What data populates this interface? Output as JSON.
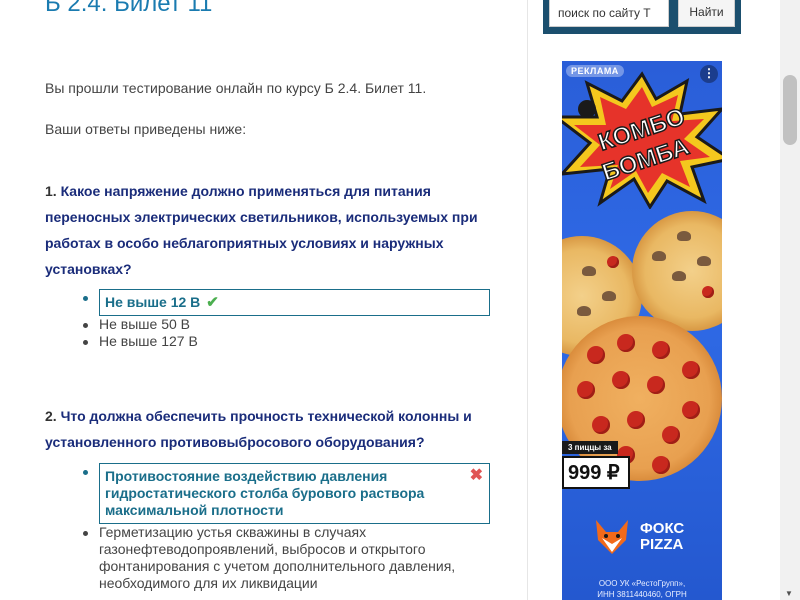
{
  "page": {
    "title": "Б 2.4. Билет 11",
    "intro": "Вы прошли тестирование онлайн по курсу Б 2.4. Билет 11.",
    "answers_intro": "Ваши ответы приведены ниже:"
  },
  "questions": [
    {
      "number": "1.",
      "text": "Какое напряжение должно применяться для питания переносных электрических светильников, используемых при работах в особо неблагоприятных условиях и наружных установках?",
      "answers": [
        {
          "text": "Не выше 12 В",
          "selected": true,
          "correct": true
        },
        {
          "text": "Не выше 50 В",
          "selected": false
        },
        {
          "text": "Не выше 127 В",
          "selected": false
        }
      ]
    },
    {
      "number": "2.",
      "text": "Что должна обеспечить прочность технической колонны и установленного противовыбросового оборудования?",
      "answers": [
        {
          "text": "Противостояние воздействию давления гидростатического столба бурового раствора максимальной плотности",
          "selected": true,
          "correct": false
        },
        {
          "text": "Герметизацию устья скважины в случаях газонефтеводопроявлений, выбросов и открытого фонтанирования с учетом дополнительного давления, необходимого для их ликвидации",
          "selected": false
        }
      ]
    }
  ],
  "sidebar": {
    "search": {
      "placeholder": "поиск по сайту Т",
      "value": "поиск по сайту Т",
      "button_label": "Найти"
    },
    "ad": {
      "badge": "РЕКЛАМА",
      "headline_1": "КОМБО",
      "headline_2": "БОМБА",
      "price_label": "3 пиццы за",
      "price": "999 ₽",
      "brand_1": "ФОКС",
      "brand_2": "PIZZA",
      "legal_1": "ООО УК «РестоГрупп»,",
      "legal_2": "ИНН 3811440460, ОГРН"
    }
  },
  "colors": {
    "title": "#1a7bb0",
    "question": "#1a2c7a",
    "selected_border": "#1a6e8a",
    "correct_icon": "#4caf50",
    "wrong_icon": "#e05555",
    "search_bg": "#1b4f6e",
    "ad_bg": "#2f6ae6"
  },
  "icons": {
    "correct": "check-icon",
    "wrong": "cross-icon"
  }
}
